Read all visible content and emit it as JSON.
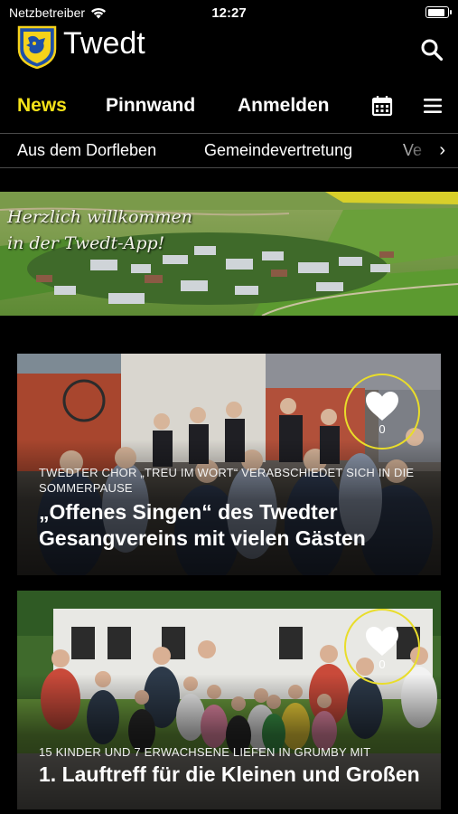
{
  "status_bar": {
    "carrier": "Netzbetreiber",
    "time": "12:27",
    "battery_level": 0.9
  },
  "header": {
    "title": "Twedt",
    "crest_icon": "coat-of-arms-icon",
    "search_icon": "search-icon"
  },
  "main_nav": {
    "items": [
      {
        "label": "News",
        "active": true
      },
      {
        "label": "Pinnwand",
        "active": false
      },
      {
        "label": "Anmelden",
        "active": false
      }
    ],
    "calendar_icon": "calendar-icon",
    "menu_icon": "hamburger-menu-icon"
  },
  "categories": {
    "items": [
      "Aus dem Dorfleben",
      "Gemeindevertretung",
      "Ve"
    ],
    "scroll_icon": "chevron-right-icon"
  },
  "banner": {
    "line1": "Herzlich willkommen",
    "line2": "in der Twedt-App!"
  },
  "articles": [
    {
      "kicker": "Twedter Chor „Treu im Wort“ verabschiedet sich in die Sommerpause",
      "title": "„Offenes Singen“ des Twedter Gesangvereins mit vielen Gästen",
      "likes": "0"
    },
    {
      "kicker": "15 Kinder und 7 Erwachsene liefen in Grumby mit",
      "title": "1. Lauftreff für die Kleinen und Großen",
      "likes": "0"
    }
  ],
  "colors": {
    "accent": "#f5e219",
    "background": "#000000",
    "fav_ring": "#e9dd2a",
    "crest_blue": "#1d4fa8",
    "crest_yellow": "#f5d21a"
  }
}
